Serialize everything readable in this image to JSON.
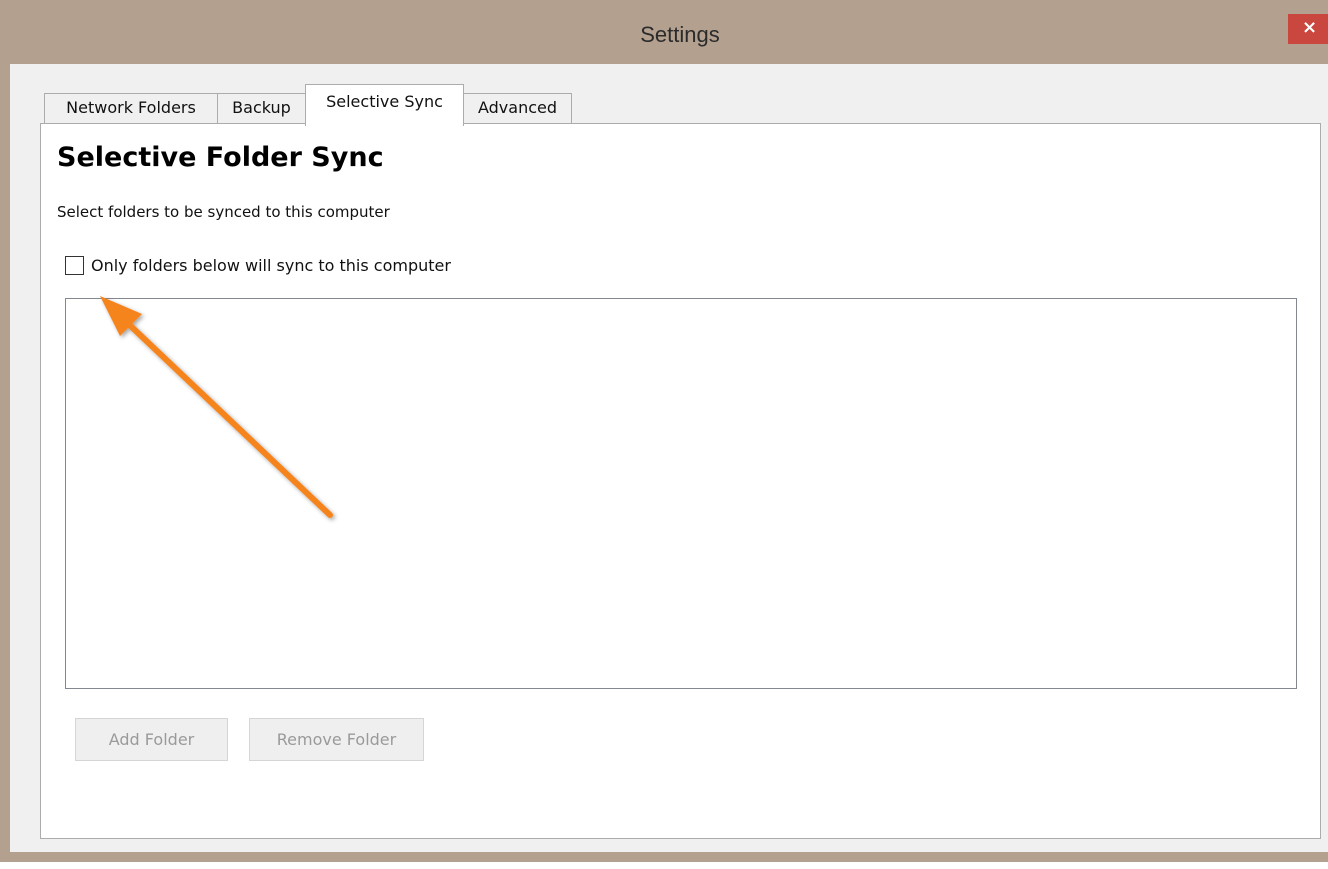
{
  "window": {
    "title": "Settings",
    "close_glyph": "×"
  },
  "tabs": [
    {
      "label": "Network Folders",
      "active": false
    },
    {
      "label": "Backup",
      "active": false
    },
    {
      "label": "Selective Sync",
      "active": true
    },
    {
      "label": "Advanced",
      "active": false
    }
  ],
  "selective_sync": {
    "heading": "Selective Folder Sync",
    "description": "Select folders to be synced to this computer",
    "only_below_checkbox": {
      "label": "Only folders below will sync to this computer",
      "checked": false
    },
    "folders": [],
    "add_folder_label": "Add Folder",
    "remove_folder_label": "Remove Folder",
    "buttons_enabled": false
  },
  "annotation": {
    "type": "arrow",
    "color": "#f5841f",
    "points_to": "only-folders-below-checkbox"
  },
  "colors": {
    "titlebar": "#b3a08f",
    "close_button": "#c9473f",
    "disabled_text": "#9a9a9a"
  }
}
